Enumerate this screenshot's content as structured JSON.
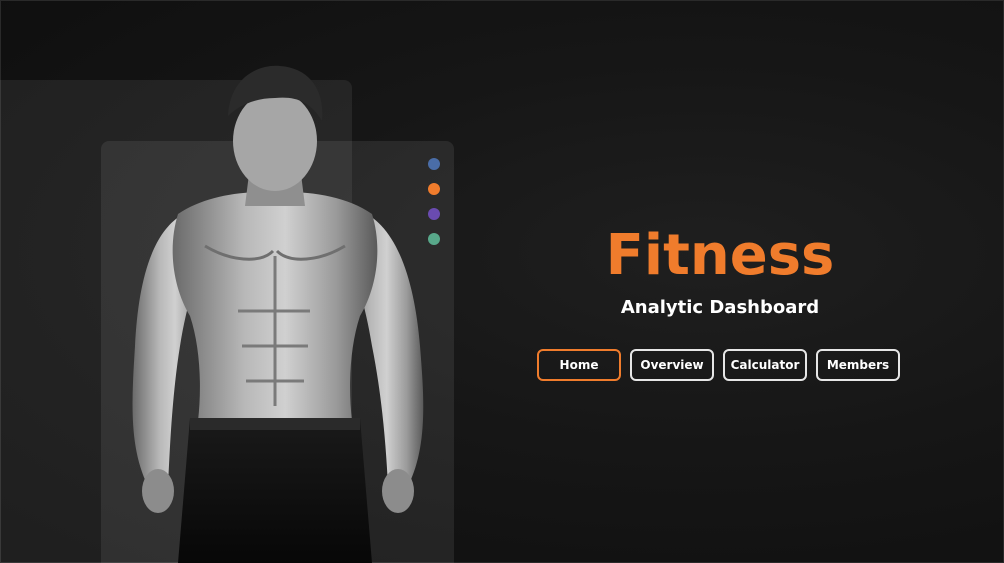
{
  "hero": {
    "title": "Fitness",
    "subtitle": "Analytic Dashboard"
  },
  "nav": [
    {
      "label": "Home",
      "active": true
    },
    {
      "label": "Overview",
      "active": false
    },
    {
      "label": "Calculator",
      "active": false
    },
    {
      "label": "Members",
      "active": false
    }
  ],
  "colors": {
    "accent": "#f07c2c",
    "dot_blue": "#4a6da7",
    "dot_orange": "#f07c2c",
    "dot_purple": "#6a4bb0",
    "dot_teal": "#58a88a"
  },
  "image": {
    "subject": "athlete-photo"
  }
}
